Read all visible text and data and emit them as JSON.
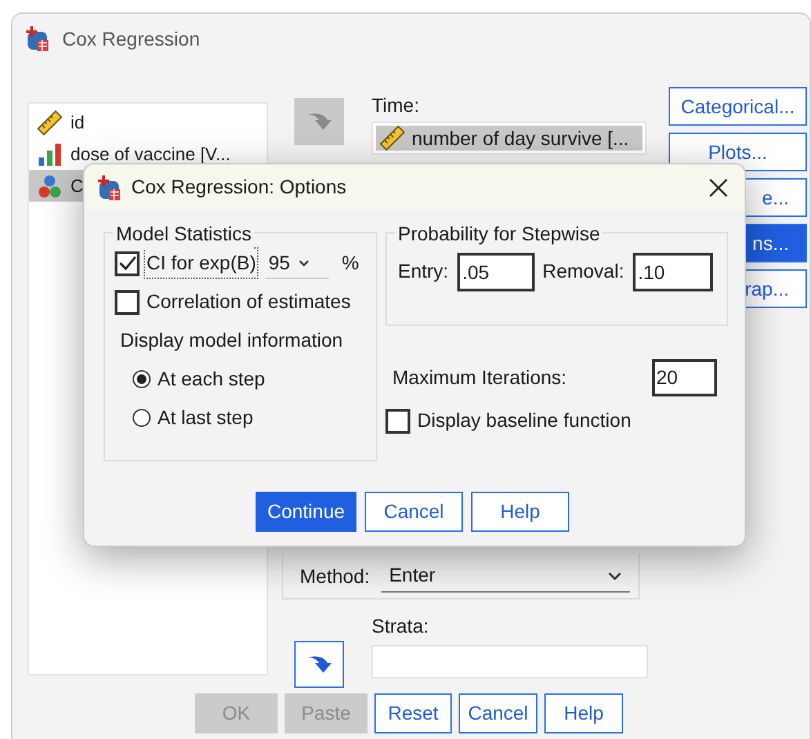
{
  "window": {
    "title": "Cox Regression"
  },
  "variables": [
    {
      "kind": "scale",
      "label": "id",
      "selected": false
    },
    {
      "kind": "ordinal",
      "label": "dose of vaccine [V...",
      "selected": false
    },
    {
      "kind": "nominal",
      "label": "C",
      "selected": true
    }
  ],
  "time": {
    "label": "Time:",
    "arrow_disabled": true,
    "value": {
      "kind": "scale",
      "label": "number of day survive [..."
    }
  },
  "side_buttons": [
    {
      "label": "Categorical...",
      "selected": false,
      "partly_covered": false
    },
    {
      "label": "Plots...",
      "selected": false,
      "partly_covered": false
    },
    {
      "label": "e...",
      "selected": false,
      "partly_covered": true
    },
    {
      "label": "ns...",
      "selected": true,
      "partly_covered": true
    },
    {
      "label": "rap...",
      "selected": false,
      "partly_covered": true
    }
  ],
  "method": {
    "label": "Method:",
    "value": "Enter"
  },
  "strata": {
    "label": "Strata:",
    "arrow_disabled": false
  },
  "buttons": [
    {
      "label": "OK",
      "disabled": true
    },
    {
      "label": "Paste",
      "disabled": true
    },
    {
      "label": "Reset",
      "disabled": false
    },
    {
      "label": "Cancel",
      "disabled": false
    },
    {
      "label": "Help",
      "disabled": false
    }
  ],
  "options_dialog": {
    "title": "Cox Regression: Options",
    "model_statistics": {
      "title": "Model Statistics",
      "ci": {
        "label": "CI for exp(B)",
        "checked": true,
        "value": "95",
        "unit": "%"
      },
      "correlation": {
        "label": "Correlation of estimates",
        "checked": false
      },
      "display_title": "Display model information",
      "display_options": [
        {
          "label": "At each step",
          "selected": true
        },
        {
          "label": "At last step",
          "selected": false
        }
      ]
    },
    "stepwise": {
      "title": "Probability for Stepwise",
      "entry_label": "Entry:",
      "entry": ".05",
      "removal_label": "Removal:",
      "removal": ".10"
    },
    "max_iterations": {
      "label": "Maximum Iterations:",
      "value": "20"
    },
    "baseline": {
      "label": "Display baseline function",
      "checked": false
    },
    "buttons": [
      {
        "label": "Continue",
        "primary": true
      },
      {
        "label": "Cancel",
        "primary": false
      },
      {
        "label": "Help",
        "primary": false
      }
    ]
  }
}
